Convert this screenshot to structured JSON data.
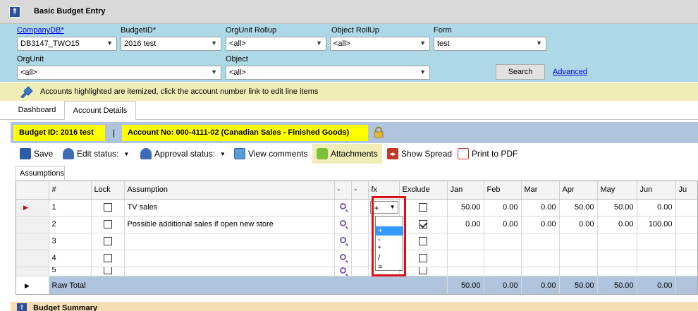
{
  "window": {
    "title": "Basic Budget Entry"
  },
  "filters": {
    "company_db": {
      "label": "CompanyDB*",
      "value": "DB3147_TWO15"
    },
    "budget_id": {
      "label": "BudgetID*",
      "value": "2016 test"
    },
    "orgunit_rollup": {
      "label": "OrgUnit Rollup",
      "value": "<all>"
    },
    "object_rollup": {
      "label": "Object RollUp",
      "value": "<all>"
    },
    "form": {
      "label": "Form",
      "value": "test"
    },
    "orgunit": {
      "label": "OrgUnit",
      "value": "<all>"
    },
    "object": {
      "label": "Object",
      "value": "<all>"
    },
    "search_label": "Search",
    "advanced_label": "Advanced"
  },
  "info": {
    "message": "Accounts highlighted are itemized, click the account number link to edit line items"
  },
  "tabs": [
    {
      "label": "Dashboard"
    },
    {
      "label": "Account Details"
    }
  ],
  "budget_bar": {
    "budget_id": "Budget ID: 2016 test",
    "separator": "|",
    "account": "Account No: 000-4111-02 (Canadian Sales - Finished Goods)"
  },
  "toolbar": {
    "save": "Save",
    "edit_status": "Edit status:",
    "approval_status": "Approval status:",
    "view_comments": "View comments",
    "attachments": "Attachments",
    "show_spread": "Show Spread",
    "print_pdf": "Print to PDF"
  },
  "subtab": {
    "label": "Assumptions"
  },
  "grid": {
    "columns": [
      "#",
      "Lock",
      "Assumption",
      "-",
      "-",
      "fx",
      "Exclude",
      "Jan",
      "Feb",
      "Mar",
      "Apr",
      "May",
      "Jun",
      "Ju"
    ],
    "rows": [
      {
        "num": "1",
        "assumption": "TV sales",
        "fx": "+",
        "exclude": false,
        "values": [
          "50.00",
          "0.00",
          "0.00",
          "50.00",
          "50.00",
          "0.00"
        ]
      },
      {
        "num": "2",
        "assumption": "Possible additional sales if open new store",
        "fx": "",
        "exclude": true,
        "values": [
          "0.00",
          "0.00",
          "0.00",
          "0.00",
          "0.00",
          "100.00"
        ]
      },
      {
        "num": "3",
        "assumption": "",
        "fx": "",
        "exclude": false,
        "values": [
          "",
          "",
          "",
          "",
          "",
          ""
        ]
      },
      {
        "num": "4",
        "assumption": "",
        "fx": "",
        "exclude": false,
        "values": [
          "",
          "",
          "",
          "",
          "",
          ""
        ]
      },
      {
        "num": "5",
        "assumption": "",
        "fx": "",
        "exclude": false,
        "values": [
          "",
          "",
          "",
          "",
          "",
          ""
        ]
      }
    ],
    "total": {
      "label": "Raw Total",
      "values": [
        "50.00",
        "0.00",
        "0.00",
        "50.00",
        "50.00",
        "0.00"
      ]
    }
  },
  "fx_options": [
    "+",
    "-",
    "*",
    "/",
    "="
  ],
  "fx_selected": "+",
  "summary": {
    "title": "Budget Summary"
  },
  "colors": {
    "filter_bg": "#add8e6",
    "info_bg": "#f0edb6",
    "highlight": "#ffff00",
    "total_bg": "#b0c4de",
    "annotation": "#d9101a"
  }
}
